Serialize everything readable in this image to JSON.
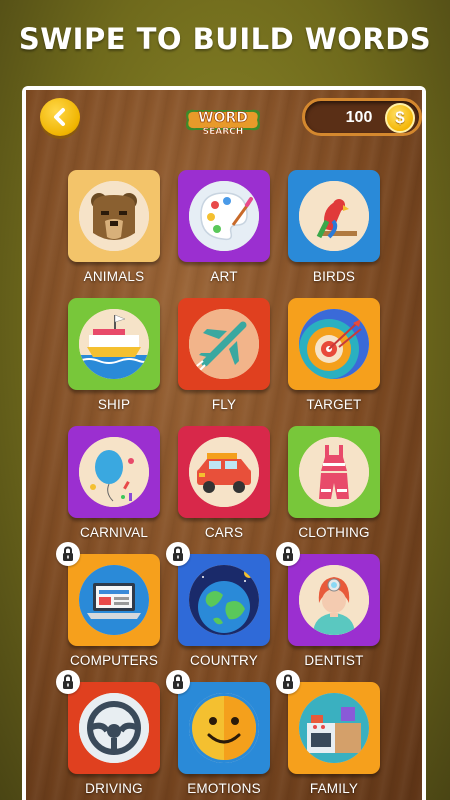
{
  "header": {
    "headline": "SWIPE TO BUILD WORDS"
  },
  "toolbar": {
    "logo_line1": "WORD",
    "logo_line2": "SEARCH",
    "coins": "100",
    "coin_symbol": "$"
  },
  "categories": [
    {
      "label": "ANIMALS",
      "icon": "bear-icon",
      "color": "#f3c46a",
      "locked": false
    },
    {
      "label": "ART",
      "icon": "palette-icon",
      "color": "#9b2fd0",
      "locked": false
    },
    {
      "label": "BIRDS",
      "icon": "parrot-icon",
      "color": "#2a8ad8",
      "locked": false
    },
    {
      "label": "SHIP",
      "icon": "ship-icon",
      "color": "#78c73a",
      "locked": false
    },
    {
      "label": "FLY",
      "icon": "airplane-icon",
      "color": "#e0401f",
      "locked": false
    },
    {
      "label": "TARGET",
      "icon": "target-icon",
      "color": "#f6a01c",
      "locked": false
    },
    {
      "label": "CARNIVAL",
      "icon": "balloon-icon",
      "color": "#9b2fd0",
      "locked": false
    },
    {
      "label": "CARS",
      "icon": "car-icon",
      "color": "#d8284a",
      "locked": false
    },
    {
      "label": "CLOTHING",
      "icon": "dress-icon",
      "color": "#78c73a",
      "locked": false
    },
    {
      "label": "COMPUTERS",
      "icon": "laptop-icon",
      "color": "#f6a01c",
      "locked": true
    },
    {
      "label": "COUNTRY",
      "icon": "globe-icon",
      "color": "#2f6ad8",
      "locked": true
    },
    {
      "label": "DENTIST",
      "icon": "dentist-icon",
      "color": "#9b2fd0",
      "locked": true
    },
    {
      "label": "DRIVING",
      "icon": "steering-wheel-icon",
      "color": "#e0401f",
      "locked": true
    },
    {
      "label": "EMOTIONS",
      "icon": "smiley-icon",
      "color": "#2a8ad8",
      "locked": true
    },
    {
      "label": "FAMILY",
      "icon": "kitchen-icon",
      "color": "#f6a01c",
      "locked": true
    }
  ]
}
